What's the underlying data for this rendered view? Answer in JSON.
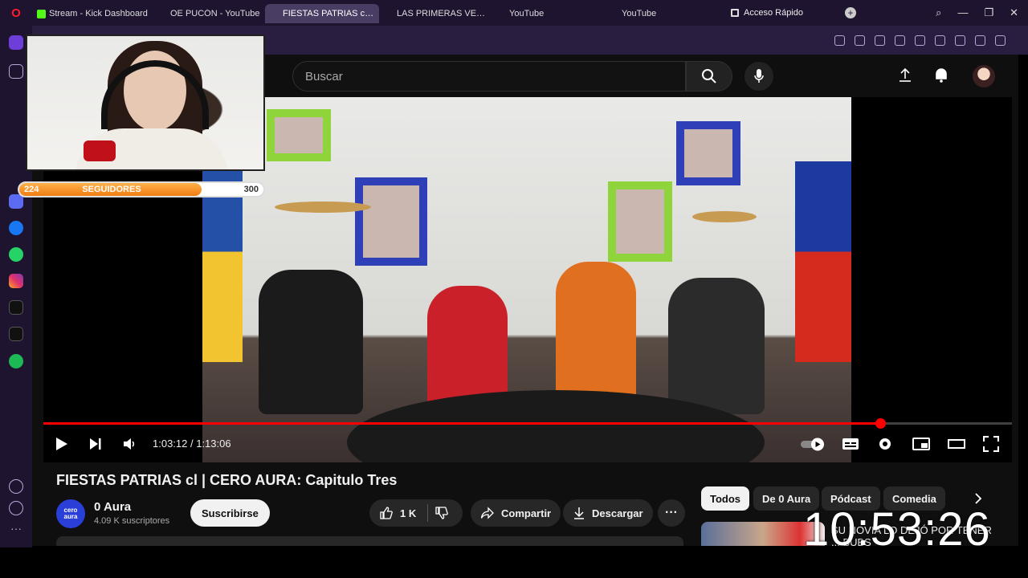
{
  "browser": {
    "tabs": [
      {
        "label": "Stream - Kick Dashboard",
        "favicon": "kick-icon",
        "active": false
      },
      {
        "label": "OE PUCÓN - YouTube",
        "favicon": "youtube-icon",
        "active": false
      },
      {
        "label": "FIESTAS PATRIAS cl | CERO",
        "favicon": "youtube-icon",
        "active": true
      },
      {
        "label": "LAS PRIMERAS VECES | CE",
        "favicon": "youtube-icon",
        "active": false
      },
      {
        "label": "YouTube",
        "favicon": "youtube-icon",
        "active": false
      },
      {
        "label": "YouTube",
        "favicon": "youtube-icon",
        "active": false
      }
    ],
    "quick_access": "Acceso Rápido"
  },
  "youtube": {
    "search_placeholder": "Buscar",
    "player": {
      "time_current": "1:03:12",
      "time_total": "1:13:06",
      "time_display": "1:03:12 / 1:13:06",
      "progress_fraction": 0.864
    },
    "video": {
      "title": "FIESTAS PATRIAS cl | CERO AURA: Capitulo Tres",
      "channel_name": "0 Aura",
      "channel_avatar_text": "cero aura",
      "subscribers": "4.09 K suscriptores",
      "subscribe_label": "Suscribirse",
      "likes": "1 K",
      "share_label": "Compartir",
      "download_label": "Descargar"
    },
    "chips": [
      "Todos",
      "De 0 Aura",
      "Pódcast",
      "Comedia"
    ],
    "recommendation_title": "SU NOVIA LO DEJÓ POR TENER ... BUBS"
  },
  "overlay": {
    "followers_label": "SEGUIDORES",
    "followers_current": "224",
    "followers_goal": "300",
    "followers_fraction": 0.747,
    "clock": "10:53:26"
  },
  "colors": {
    "accent_red": "#ff0000",
    "browser_bg": "#1e1430",
    "youtube_bg": "#0f0f0f",
    "follow_bar": "#f07d12"
  }
}
